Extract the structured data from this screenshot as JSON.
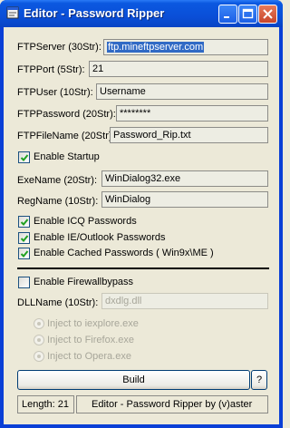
{
  "window": {
    "title": "Editor - Password Ripper",
    "controls": [
      "minimize-icon",
      "maximize-icon",
      "close-icon"
    ]
  },
  "fields": {
    "ftp_server": {
      "label": "FTPServer (30Str):",
      "value": "ftp.mineftpserver.com"
    },
    "ftp_port": {
      "label": "FTPPort (5Str):",
      "value": "21"
    },
    "ftp_user": {
      "label": "FTPUser (10Str):",
      "value": "Username"
    },
    "ftp_password": {
      "label": "FTPPassword (20Str):",
      "value": "********"
    },
    "ftp_filename": {
      "label": "FTPFileName (20Str):",
      "value": "Password_Rip.txt"
    },
    "exe_name": {
      "label": "ExeName (20Str):",
      "value": "WinDialog32.exe"
    },
    "reg_name": {
      "label": "RegName (10Str):",
      "value": "WinDialog"
    },
    "dll_name": {
      "label": "DLLName (10Str):",
      "value": "dxdlg.dll"
    }
  },
  "checkboxes": {
    "startup": {
      "label": "Enable Startup",
      "checked": true
    },
    "icq": {
      "label": "Enable ICQ Passwords",
      "checked": true
    },
    "ie_outlook": {
      "label": "Enable IE/Outlook Passwords",
      "checked": true
    },
    "cached": {
      "label": "Enable Cached Passwords ( Win9x\\ME )",
      "checked": true
    },
    "firewall": {
      "label": "Enable Firewallbypass",
      "checked": false
    }
  },
  "radios": [
    {
      "label": "Inject to iexplore.exe"
    },
    {
      "label": "Inject to Firefox.exe"
    },
    {
      "label": "Inject to Opera.exe"
    }
  ],
  "buttons": {
    "build": "Build",
    "help": "?"
  },
  "status": {
    "length": "Length: 21",
    "credit": "Editor - Password Ripper by (v)aster"
  }
}
